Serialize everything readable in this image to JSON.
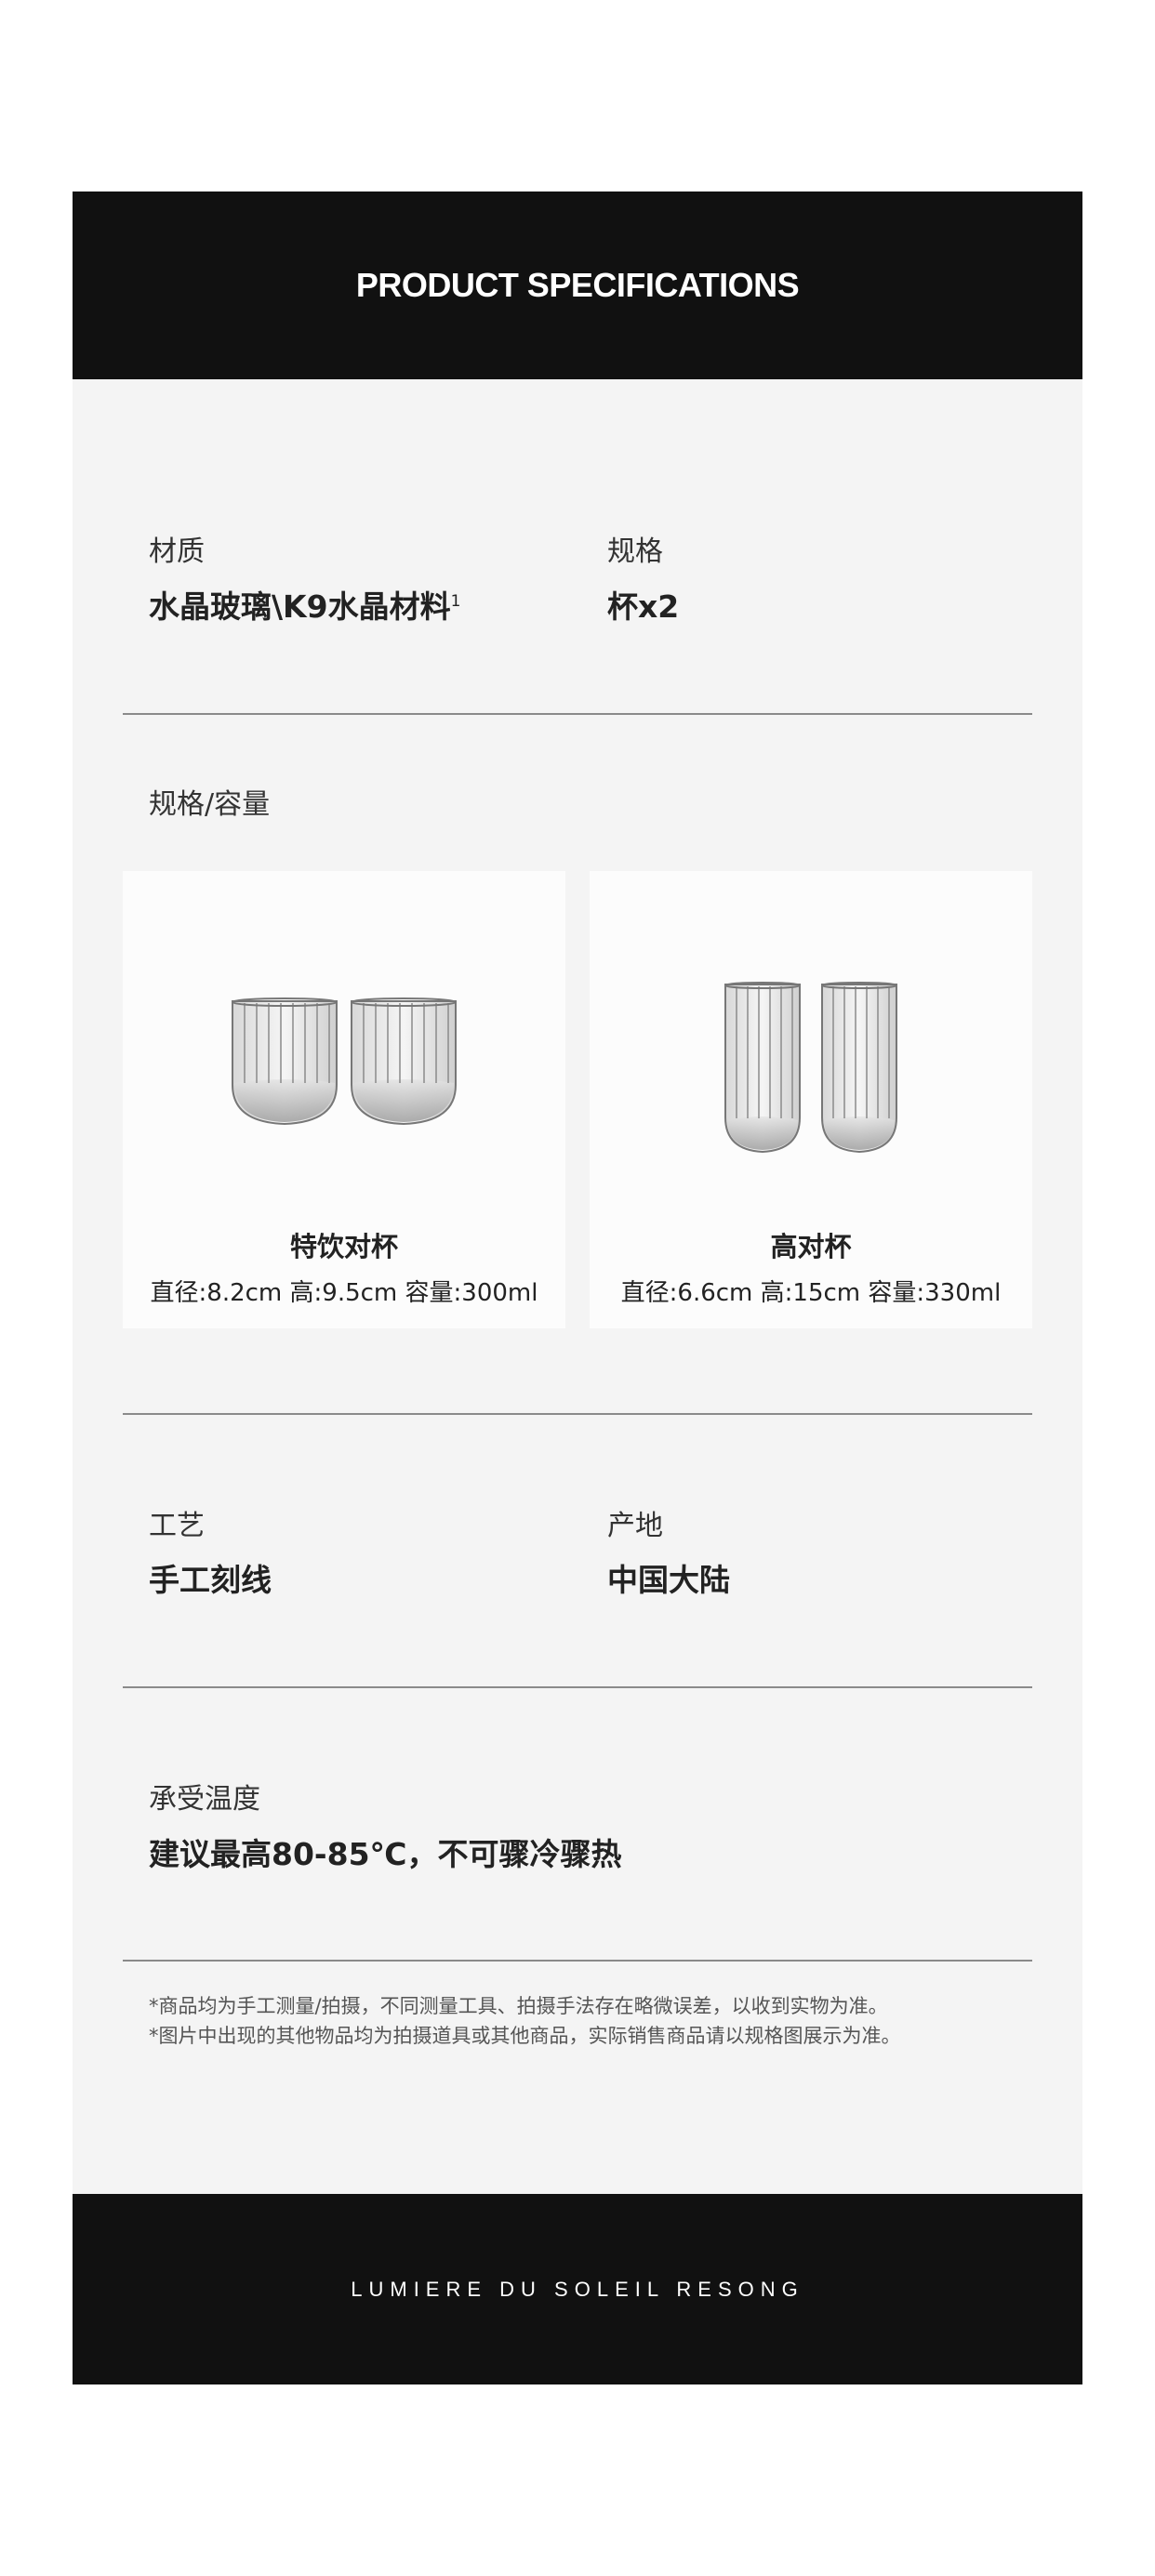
{
  "header": {
    "title": "PRODUCT SPECIFICATIONS"
  },
  "specs": {
    "material": {
      "label": "材质",
      "value": "水晶玻璃\\K9水晶材料",
      "footnote": "1"
    },
    "spec": {
      "label": "规格",
      "value": "杯x2"
    },
    "capacity": {
      "label": "规格/容量"
    },
    "craft": {
      "label": "工艺",
      "value": "手工刻线"
    },
    "origin": {
      "label": "产地",
      "value": "中国大陆"
    },
    "temperature": {
      "label": "承受温度",
      "value": "建议最高80-85℃，不可骤冷骤热"
    }
  },
  "products": [
    {
      "name": "特饮对杯",
      "dims": "直径:8.2cm 高:9.5cm 容量:300ml"
    },
    {
      "name": "高对杯",
      "dims": "直径:6.6cm 高:15cm 容量:330ml"
    }
  ],
  "notes": [
    "*商品均为手工测量/拍摄，不同测量工具、拍摄手法存在略微误差，以收到实物为准。",
    "*图片中出现的其他物品均为拍摄道具或其他商品，实际销售商品请以规格图展示为准。"
  ],
  "footer": {
    "text": "LUMIERE DU SOLEIL RESONG"
  },
  "colors": {
    "band": "#111111",
    "card": "#f4f4f4",
    "tile": "#fcfcfc"
  }
}
